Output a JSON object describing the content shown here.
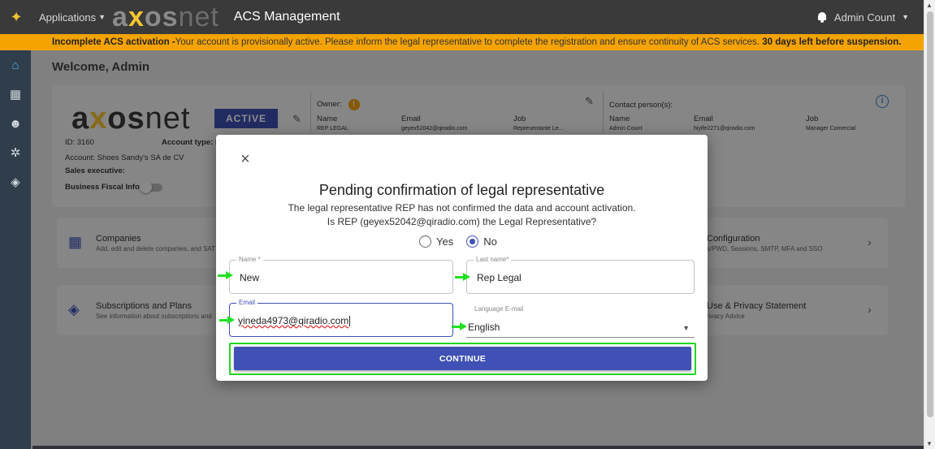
{
  "topbar": {
    "applications_label": "Applications",
    "logo_text_a": "a",
    "logo_text_x": "x",
    "logo_text_os": "os",
    "logo_text_net": "net",
    "app_title": "ACS Management",
    "user_name": "Admin Count"
  },
  "banner": {
    "bold_prefix": "Incomplete ACS activation -",
    "message": "Your account is provisionally active. Please inform the legal representative to complete the registration and ensure continuity of ACS services.",
    "bold_suffix": "30 days left before suspension."
  },
  "page": {
    "welcome": "Welcome, Admin",
    "status_badge": "ACTIVE",
    "id_label": "ID: 3160",
    "account_type_label": "Account type: P",
    "account_label": "Account: Shoes Sandy's SA de CV",
    "sales_exec_label": "Sales executive:",
    "fiscal_info_label": "Business Fiscal Info:",
    "owner_label": "Owner:",
    "owner_headers": [
      "Name",
      "Email",
      "Job"
    ],
    "owner_values": [
      "REP LEGAL",
      "geyex52042@qiradio.com",
      "Representante Le..."
    ],
    "contact_label": "Contact person(s):",
    "contact_headers": [
      "Name",
      "Email",
      "Job"
    ],
    "contact_values": [
      "Admin Count",
      "hiyife2271@qiradio.com",
      "Manager Comercial"
    ],
    "tiles": [
      {
        "title": "Companies",
        "subtitle": "Add, edit and delete companies, and SAT"
      },
      {
        "title": "Configuration",
        "subtitle": "s/PWD, Sessions, SMTP, MFA and SSO"
      },
      {
        "title": "Subscriptions and Plans",
        "subtitle": "See information about subscriptions and"
      },
      {
        "title": "Use & Privacy Statement",
        "subtitle": "rivacy Advice"
      }
    ]
  },
  "modal": {
    "close_glyph": "×",
    "title": "Pending confirmation of legal representative",
    "line1": "The legal representative REP has not confirmed the data and account activation.",
    "line2": "Is REP (geyex52042@qiradio.com) the Legal Representative?",
    "radio_yes": "Yes",
    "radio_no": "No",
    "selected": "No",
    "name_label": "Name *",
    "name_value": "New",
    "lastname_label": "Last name*",
    "lastname_value": "Rep Legal",
    "email_label": "Email",
    "email_value": "yineda4973@qiradio.com",
    "language_label": "Language E-mail",
    "language_value": "English",
    "continue_label": "CONTINUE"
  },
  "colors": {
    "primary": "#3f51b5",
    "banner": "#f5a300",
    "highlight": "#22d622",
    "topbar": "#3a3a3a",
    "sidebar": "#2f3e4a"
  },
  "icons": {
    "sidebar": [
      "home-icon",
      "building-icon",
      "users-icon",
      "gear-icon",
      "layers-icon"
    ]
  }
}
